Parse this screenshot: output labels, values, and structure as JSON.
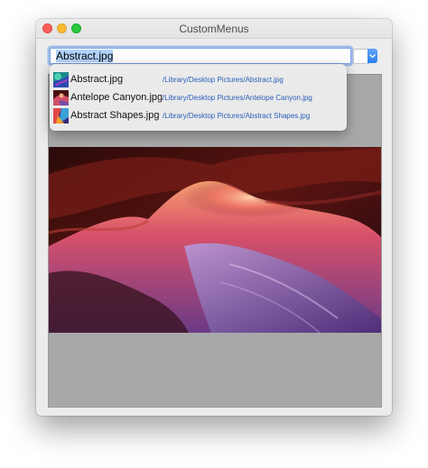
{
  "window": {
    "title": "CustomMenus"
  },
  "search": {
    "value": "Abstract.jpg"
  },
  "suggestions": [
    {
      "name": "Abstract.jpg",
      "path": "/Library/Desktop Pictures/Abstract.jpg",
      "thumbnail": "abstract-thumbnail"
    },
    {
      "name": "Antelope Canyon.jpg",
      "path": "/Library/Desktop Pictures/Antelope Canyon.jpg",
      "thumbnail": "canyon-thumbnail"
    },
    {
      "name": "Abstract Shapes.jpg",
      "path": "/Library/Desktop Pictures/Abstract Shapes.jpg",
      "thumbnail": "shapes-thumbnail"
    }
  ],
  "colors": {
    "close": "#fc5f57",
    "minimize": "#fdbc2e",
    "zoom": "#29c840",
    "focus_ring": "#7aa7e9",
    "selection": "#b3d3fd",
    "path_text": "#2a5db8",
    "image_well": "#a8a8a8"
  },
  "icons": {
    "popup": "chevron-down-icon"
  }
}
